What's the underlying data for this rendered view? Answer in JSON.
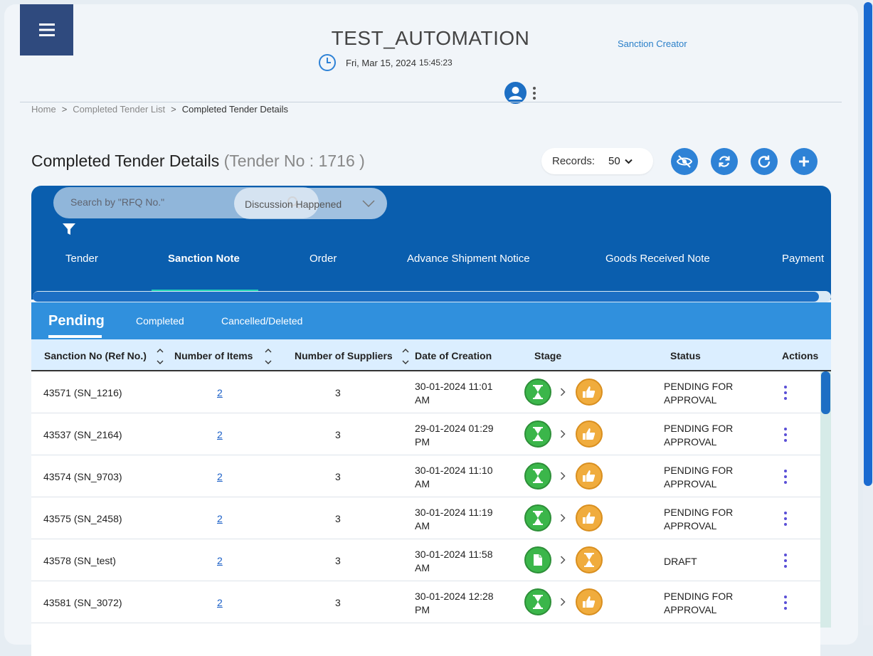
{
  "header": {
    "app_title": "TEST_AUTOMATION",
    "date": "Fri, Mar 15, 2024",
    "time": "15:45:23",
    "role": "Sanction Creator"
  },
  "breadcrumb": {
    "items": [
      "Home",
      "Completed Tender List",
      "Completed Tender Details"
    ],
    "separator": ">"
  },
  "page": {
    "title": "Completed Tender Details",
    "subtitle": "(Tender No : 1716 )"
  },
  "records": {
    "label": "Records:",
    "value": "50"
  },
  "toolbar_icons": [
    "eye-off-icon",
    "sync-icon",
    "refresh-icon",
    "plus-icon"
  ],
  "search": {
    "placeholder": "Search by \"RFQ No.\""
  },
  "filter_dropdown": {
    "value": "Discussion Happened"
  },
  "main_tabs": [
    {
      "label": "Tender",
      "active": false
    },
    {
      "label": "Sanction Note",
      "active": true
    },
    {
      "label": "Order",
      "active": false
    },
    {
      "label": "Advance Shipment Notice",
      "active": false
    },
    {
      "label": "Goods Received Note",
      "active": false
    },
    {
      "label": "Payment",
      "active": false
    }
  ],
  "sub_tabs": [
    {
      "label": "Pending",
      "active": true
    },
    {
      "label": "Completed",
      "active": false
    },
    {
      "label": "Cancelled/Deleted",
      "active": false
    }
  ],
  "table": {
    "columns": [
      "Sanction No (Ref No.)",
      "Number of Items",
      "Number of Suppliers",
      "Date of Creation",
      "Stage",
      "Status",
      "Actions"
    ],
    "rows": [
      {
        "id": "43571 (SN_1216)",
        "items": "2",
        "suppliers": "3",
        "date_line1": "30-01-2024 11:01",
        "date_line2": "AM",
        "stage_from": "hourglass",
        "stage_to": "thumbs-up",
        "status_line1": "PENDING FOR",
        "status_line2": "APPROVAL"
      },
      {
        "id": "43537 (SN_2164)",
        "items": "2",
        "suppliers": "3",
        "date_line1": "29-01-2024 01:29",
        "date_line2": "PM",
        "stage_from": "hourglass",
        "stage_to": "thumbs-up",
        "status_line1": "PENDING FOR",
        "status_line2": "APPROVAL"
      },
      {
        "id": "43574 (SN_9703)",
        "items": "2",
        "suppliers": "3",
        "date_line1": "30-01-2024 11:10",
        "date_line2": "AM",
        "stage_from": "hourglass",
        "stage_to": "thumbs-up",
        "status_line1": "PENDING FOR",
        "status_line2": "APPROVAL"
      },
      {
        "id": "43575 (SN_2458)",
        "items": "2",
        "suppliers": "3",
        "date_line1": "30-01-2024 11:19",
        "date_line2": "AM",
        "stage_from": "hourglass",
        "stage_to": "thumbs-up",
        "status_line1": "PENDING FOR",
        "status_line2": "APPROVAL"
      },
      {
        "id": "43578 (SN_test)",
        "items": "2",
        "suppliers": "3",
        "date_line1": "30-01-2024 11:58",
        "date_line2": "AM",
        "stage_from": "document",
        "stage_to": "hourglass",
        "status_line1": "DRAFT",
        "status_line2": ""
      },
      {
        "id": "43581 (SN_3072)",
        "items": "2",
        "suppliers": "3",
        "date_line1": "30-01-2024 12:28",
        "date_line2": "PM",
        "stage_from": "hourglass",
        "stage_to": "thumbs-up",
        "status_line1": "PENDING FOR",
        "status_line2": "APPROVAL"
      }
    ]
  },
  "colors": {
    "menu_bg": "#2f4a7e",
    "panel_bg": "#0a5eae",
    "subtab_bg": "#3090dd",
    "accent": "#2e82d6",
    "tab_underline": "#1fd4b5",
    "stage_green": "#3bb64a",
    "stage_orange": "#f0ac3d"
  }
}
